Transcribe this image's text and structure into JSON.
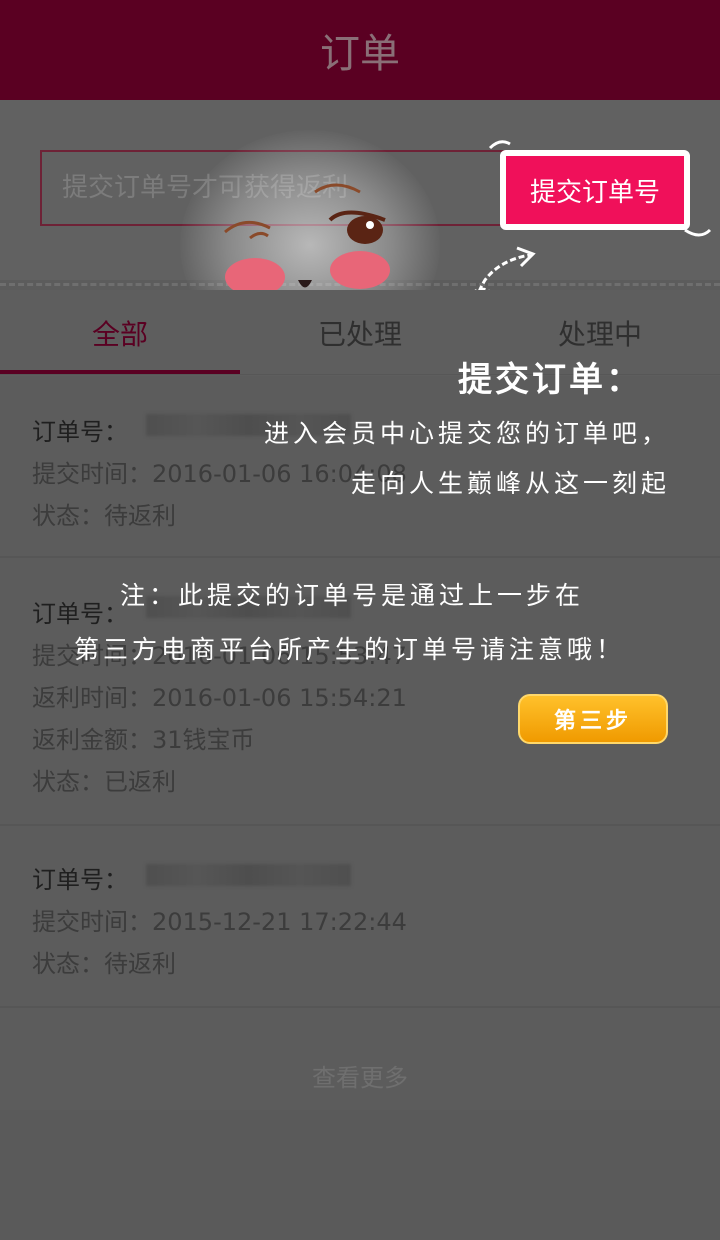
{
  "header": {
    "title": "订单"
  },
  "search": {
    "placeholder": "提交订单号才可获得返利",
    "value": "",
    "submit_label": "提交订单号"
  },
  "tabs": [
    {
      "label": "全部",
      "active": true
    },
    {
      "label": "已处理",
      "active": false
    },
    {
      "label": "处理中",
      "active": false
    }
  ],
  "orders": [
    {
      "order_no_label": "订单号：",
      "submit_time": "提交时间：2016-01-06 16:04:08",
      "status": "状态：待返利"
    },
    {
      "order_no_label": "订单号：",
      "submit_time": "提交时间：2016-01-06 15:53:47",
      "rebate_time": "返利时间：2016-01-06 15:54:21",
      "rebate_amount": "返利金额：31钱宝币",
      "status": "状态：已返利"
    },
    {
      "order_no_label": "订单号：",
      "submit_time": "提交时间：2015-12-21 17:22:44",
      "status": "状态：待返利"
    }
  ],
  "more_label": "查看更多",
  "tutorial": {
    "title": "提交订单：",
    "line1": "进入会员中心提交您的订单吧，",
    "line2": "走向人生巅峰从这一刻起",
    "note1": "注：此提交的订单号是通过上一步在",
    "note2": "第三方电商平台所产生的订单号请注意哦！",
    "step_badge": "第三步"
  },
  "colors": {
    "header_bg": "#5a0022",
    "accent": "#f0105a",
    "overlay_bg": "#5c5c5c",
    "step_badge": "#f7a70f"
  },
  "icons": [
    "face-icon",
    "curly-arrow-icon"
  ]
}
